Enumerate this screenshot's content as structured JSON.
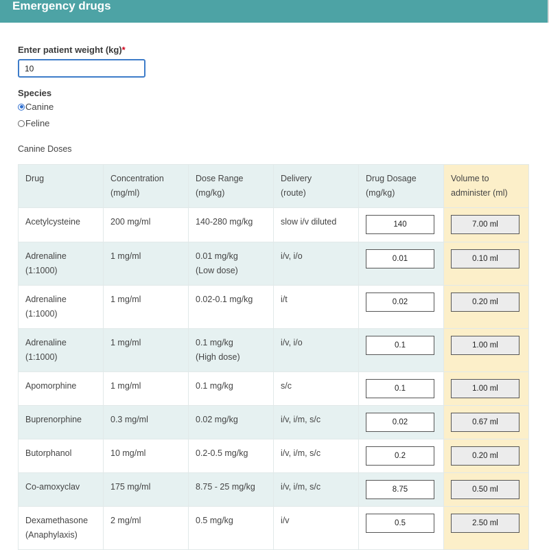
{
  "header": {
    "title": "Emergency drugs"
  },
  "form": {
    "weight_label": "Enter patient weight (kg)",
    "weight_required": "*",
    "weight_value": "10",
    "species_label": "Species",
    "species_options": [
      {
        "label": "Canine",
        "selected": true
      },
      {
        "label": "Feline",
        "selected": false
      }
    ]
  },
  "table": {
    "caption": "Canine Doses",
    "headers": {
      "drug": "Drug",
      "concentration": "Concentration",
      "concentration_unit": "(mg/ml)",
      "dose_range": "Dose Range",
      "dose_range_unit": "(mg/kg)",
      "delivery": "Delivery",
      "delivery_unit": "(route)",
      "dosage": "Drug Dosage",
      "dosage_unit": "(mg/kg)",
      "volume": "Volume to",
      "volume_unit": "administer (ml)"
    },
    "rows": [
      {
        "drug": "Acetylcysteine",
        "drug_sub": "",
        "concentration": "200 mg/ml",
        "dose_range": "140-280 mg/kg",
        "dose_sub": "",
        "delivery": "slow i/v diluted",
        "dosage": "140",
        "volume": "7.00 ml"
      },
      {
        "drug": "Adrenaline",
        "drug_sub": "(1:1000)",
        "concentration": "1 mg/ml",
        "dose_range": "0.01 mg/kg",
        "dose_sub": "(Low dose)",
        "delivery": "i/v, i/o",
        "dosage": "0.01",
        "volume": "0.10 ml"
      },
      {
        "drug": "Adrenaline",
        "drug_sub": "(1:1000)",
        "concentration": "1 mg/ml",
        "dose_range": "0.02-0.1 mg/kg",
        "dose_sub": "",
        "delivery": "i/t",
        "dosage": "0.02",
        "volume": "0.20 ml"
      },
      {
        "drug": "Adrenaline",
        "drug_sub": "(1:1000)",
        "concentration": "1 mg/ml",
        "dose_range": "0.1 mg/kg",
        "dose_sub": "(High dose)",
        "delivery": "i/v, i/o",
        "dosage": "0.1",
        "volume": "1.00 ml"
      },
      {
        "drug": "Apomorphine",
        "drug_sub": "",
        "concentration": "1 mg/ml",
        "dose_range": "0.1 mg/kg",
        "dose_sub": "",
        "delivery": "s/c",
        "dosage": "0.1",
        "volume": "1.00 ml"
      },
      {
        "drug": "Buprenorphine",
        "drug_sub": "",
        "concentration": "0.3 mg/ml",
        "dose_range": "0.02 mg/kg",
        "dose_sub": "",
        "delivery": "i/v, i/m, s/c",
        "dosage": "0.02",
        "volume": "0.67 ml"
      },
      {
        "drug": "Butorphanol",
        "drug_sub": "",
        "concentration": "10 mg/ml",
        "dose_range": "0.2-0.5 mg/kg",
        "dose_sub": "",
        "delivery": "i/v, i/m, s/c",
        "dosage": "0.2",
        "volume": "0.20 ml"
      },
      {
        "drug": "Co-amoxyclav",
        "drug_sub": "",
        "concentration": "175 mg/ml",
        "dose_range": "8.75 - 25 mg/kg",
        "dose_sub": "",
        "delivery": "i/v, i/m, s/c",
        "dosage": "8.75",
        "volume": "0.50 ml"
      },
      {
        "drug": "Dexamethasone",
        "drug_sub": "(Anaphylaxis)",
        "concentration": "2 mg/ml",
        "dose_range": "0.5 mg/kg",
        "dose_sub": "",
        "delivery": "i/v",
        "dosage": "0.5",
        "volume": "2.50 ml"
      }
    ]
  }
}
